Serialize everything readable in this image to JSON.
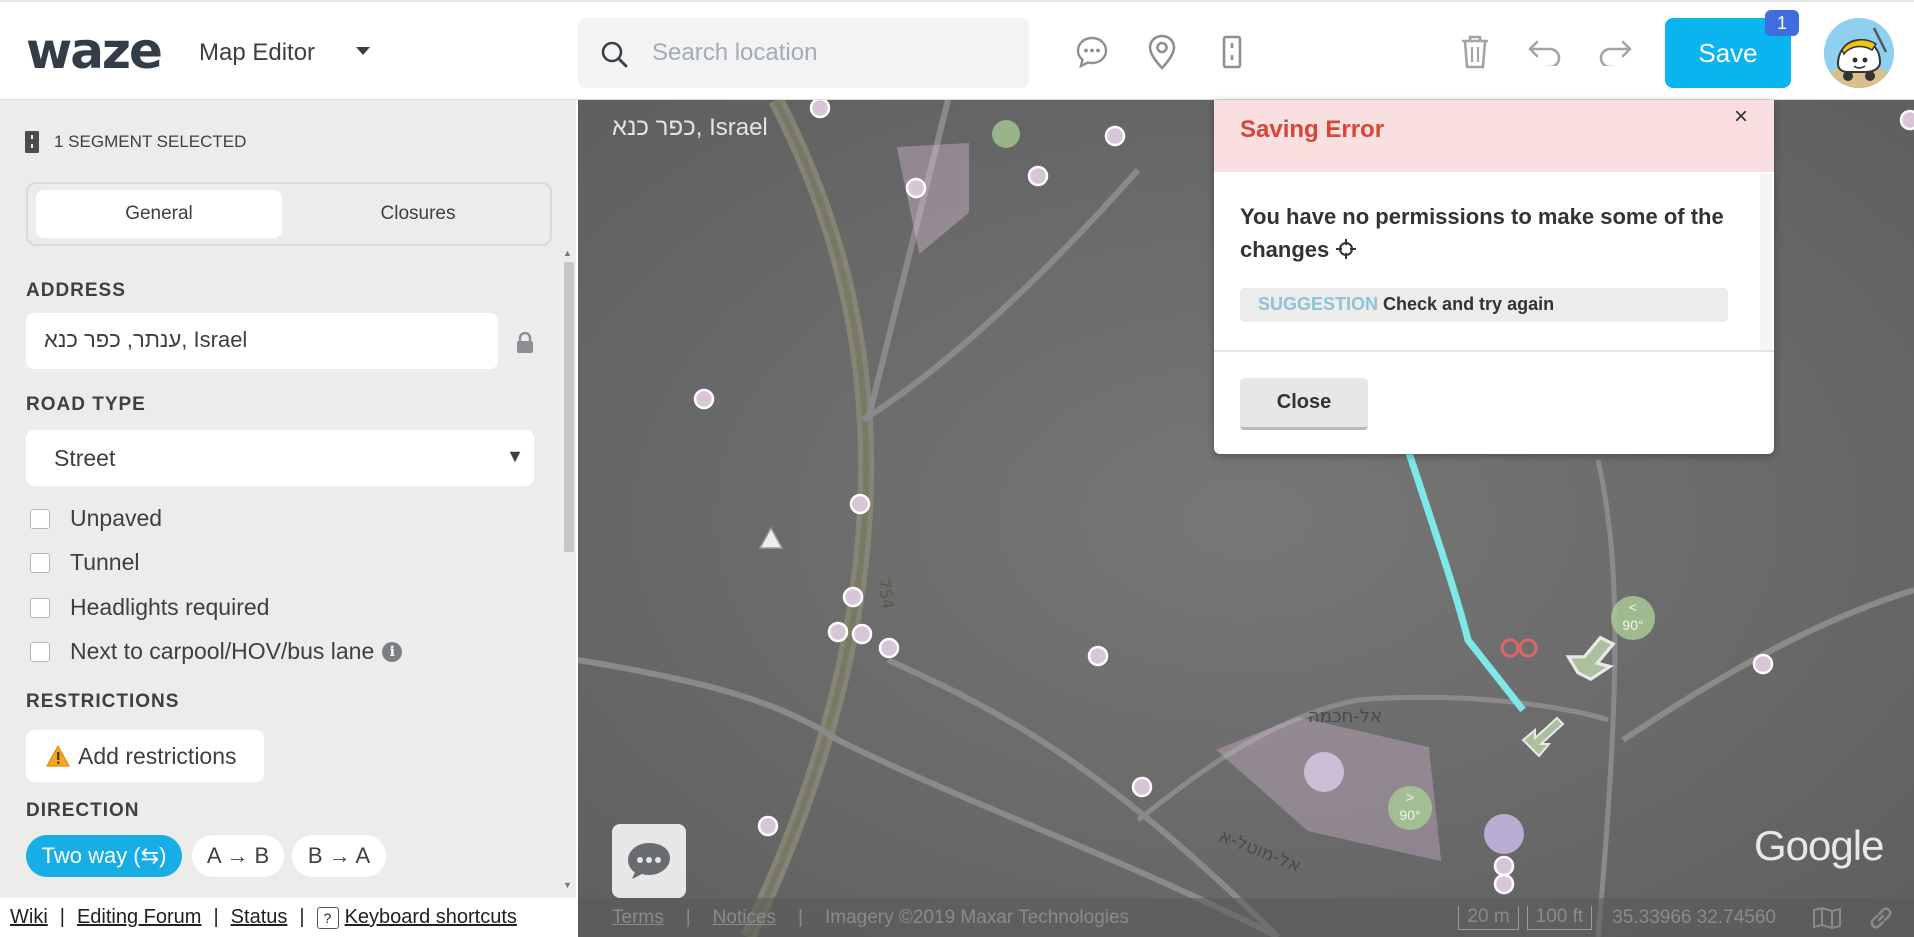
{
  "header": {
    "logo_text": "waze",
    "app_title": "Map Editor",
    "search": {
      "placeholder": "Search location"
    },
    "save_label": "Save",
    "save_badge": "1"
  },
  "sidebar": {
    "selection_label": "1 SEGMENT SELECTED",
    "tabs": [
      {
        "label": "General",
        "active": true
      },
      {
        "label": "Closures",
        "active": false
      }
    ],
    "address": {
      "label": "ADDRESS",
      "value": "ענתר, כפר כנא, Israel"
    },
    "road_type": {
      "label": "ROAD TYPE",
      "value": "Street"
    },
    "checkboxes": [
      {
        "label": "Unpaved",
        "checked": false
      },
      {
        "label": "Tunnel",
        "checked": false
      },
      {
        "label": "Headlights required",
        "checked": false
      },
      {
        "label": "Next to carpool/HOV/bus lane",
        "checked": false
      }
    ],
    "restrictions": {
      "label": "RESTRICTIONS",
      "button": "Add restrictions"
    },
    "direction": {
      "label": "DIRECTION",
      "options": [
        "Two way (⇆)",
        "A → B",
        "B → A"
      ],
      "selected": "Two way (⇆)"
    }
  },
  "footer": {
    "links": [
      "Wiki",
      "Editing Forum",
      "Status",
      "Keyboard shortcuts"
    ],
    "kb_glyph": "?"
  },
  "map": {
    "location": "כפר כנא, Israel",
    "google_logo": "Google",
    "footer": {
      "terms": "Terms",
      "notices": "Notices",
      "imagery": "Imagery ©2019 Maxar Technologies",
      "scale_m": "20 m",
      "scale_ft": "100 ft",
      "coords": "35.33966 32.74560"
    },
    "street_labels": [
      "אל-חכמה",
      "אל-מוטל-א",
      "754"
    ],
    "turn_labels": [
      "< 90°",
      "> 90°"
    ]
  },
  "dialog": {
    "title": "Saving Error",
    "close_x": "×",
    "message": "You have no permissions to make some of the changes",
    "suggestion_tag": "SUGGESTION",
    "suggestion_text": "Check and try again",
    "close_label": "Close"
  },
  "colors": {
    "accent": "#0ab5ef",
    "direction_active": "#16aee5",
    "error_title": "#d64539",
    "error_bg": "#f9dfdf",
    "badge": "#3f6cdf"
  }
}
